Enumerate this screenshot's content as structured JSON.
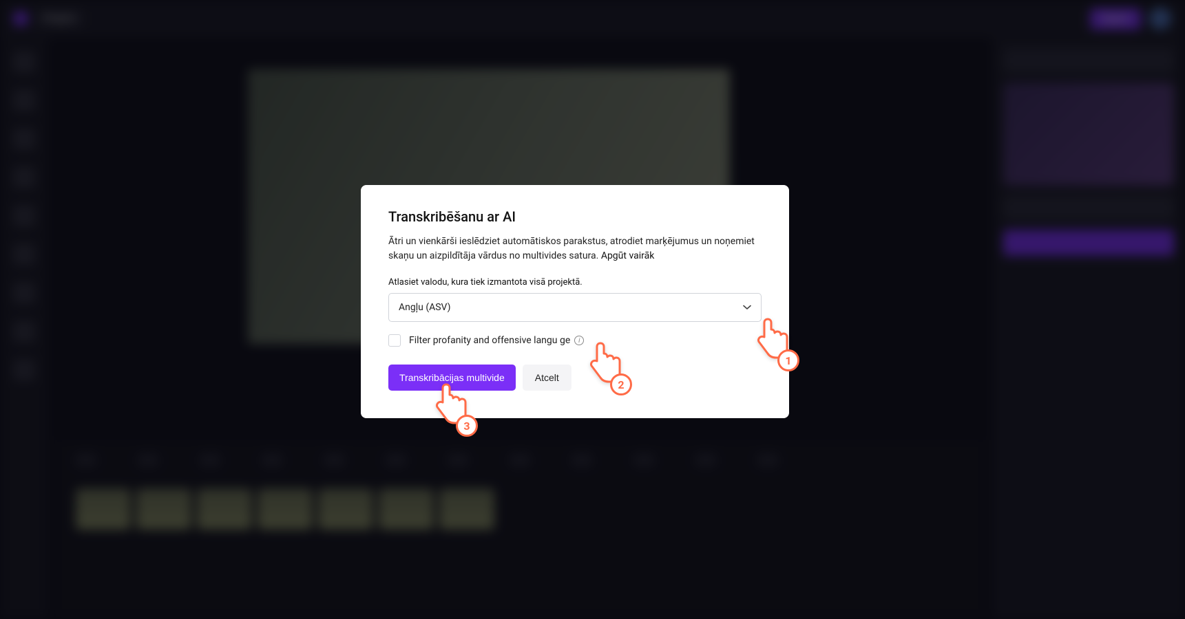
{
  "topbar": {
    "project_name": "Project",
    "undo_redo": "↶",
    "export_label": "Export"
  },
  "modal": {
    "title": "Transkribēšanu ar AI",
    "description_line1": "Ātri un vienkārši ieslēdziet automātiskos parakstus, atrodiet marķējumus un noņemiet skaņu un",
    "description_line2": "aizpildītāja vārdus no multivides satura. ",
    "learn_more": "Apgūt vairāk",
    "language_label": "Atlasiet valodu, kura tiek izmantota visā projektā.",
    "language_selected": "Angļu (ASV)",
    "filter_checkbox_label": "Filter profanity and offensive langu       ge",
    "primary_button": "Transkribācijas multivide",
    "secondary_button": "Atcelt"
  },
  "annotations": {
    "pointer1": "1",
    "pointer2": "2",
    "pointer3": "3"
  }
}
